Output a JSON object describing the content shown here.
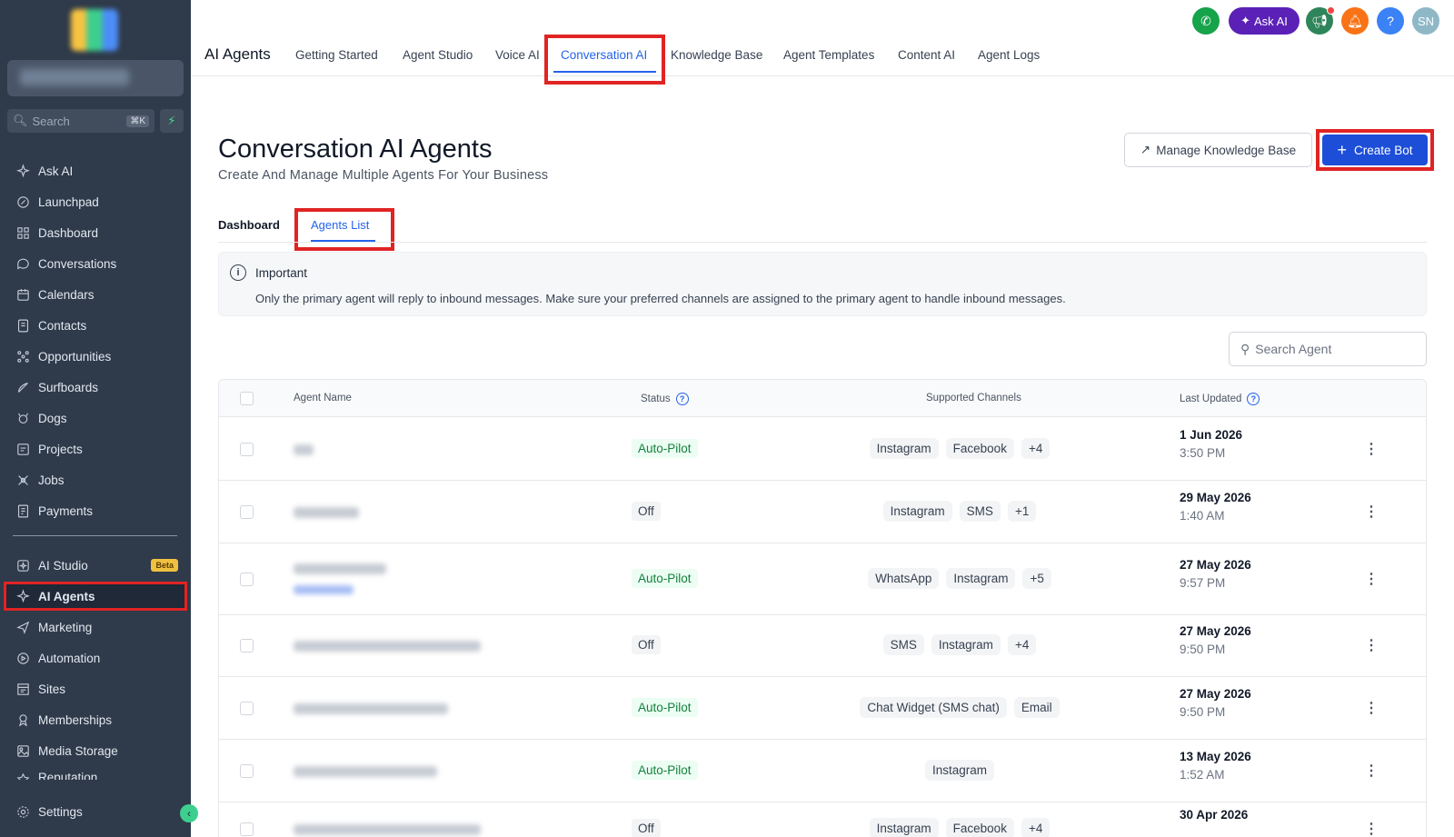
{
  "sidebar": {
    "search_placeholder": "Search",
    "search_shortcut": "⌘K",
    "items": [
      {
        "label": "Ask AI",
        "icon": "sparkle-icon"
      },
      {
        "label": "Launchpad",
        "icon": "rocket-icon"
      },
      {
        "label": "Dashboard",
        "icon": "grid-icon"
      },
      {
        "label": "Conversations",
        "icon": "chat-icon"
      },
      {
        "label": "Calendars",
        "icon": "calendar-icon"
      },
      {
        "label": "Contacts",
        "icon": "contacts-icon"
      },
      {
        "label": "Opportunities",
        "icon": "opportunities-icon"
      },
      {
        "label": "Surfboards",
        "icon": "surfboard-icon"
      },
      {
        "label": "Dogs",
        "icon": "dog-icon"
      },
      {
        "label": "Projects",
        "icon": "projects-icon"
      },
      {
        "label": "Jobs",
        "icon": "jobs-icon"
      },
      {
        "label": "Payments",
        "icon": "payments-icon"
      }
    ],
    "items2": [
      {
        "label": "AI Studio",
        "icon": "ai-studio-icon",
        "badge": "Beta"
      },
      {
        "label": "AI Agents",
        "icon": "sparkle-icon"
      },
      {
        "label": "Marketing",
        "icon": "send-icon"
      },
      {
        "label": "Automation",
        "icon": "automation-icon"
      },
      {
        "label": "Sites",
        "icon": "sites-icon"
      },
      {
        "label": "Memberships",
        "icon": "membership-icon"
      },
      {
        "label": "Media Storage",
        "icon": "image-icon"
      },
      {
        "label": "Reputation",
        "icon": "star-icon"
      }
    ],
    "settings_label": "Settings"
  },
  "topnav": {
    "brand": "AI Agents",
    "tabs": [
      "Getting Started",
      "Agent Studio",
      "Voice AI",
      "Conversation AI",
      "Knowledge Base",
      "Agent Templates",
      "Content AI",
      "Agent Logs"
    ],
    "active_tab": "Conversation AI",
    "ask_ai": "Ask AI",
    "help": "?",
    "avatar": "SN"
  },
  "page": {
    "title": "Conversation AI Agents",
    "subtitle": "Create And Manage Multiple Agents For Your Business",
    "manage_kb": "Manage Knowledge Base",
    "create_bot": "Create Bot",
    "subtabs": [
      "Dashboard",
      "Agents List"
    ],
    "notice_title": "Important",
    "notice_text": "Only the primary agent will reply to inbound messages. Make sure your preferred channels are assigned to the primary agent to handle inbound messages.",
    "search_agent": "Search Agent"
  },
  "table": {
    "headers": {
      "name": "Agent Name",
      "status": "Status",
      "channels": "Supported Channels",
      "updated": "Last Updated"
    },
    "rows": [
      {
        "status": "Auto-Pilot",
        "channels": [
          "Instagram",
          "Facebook",
          "+4"
        ],
        "date": "1 Jun 2026",
        "time": "3:50 PM"
      },
      {
        "status": "Off",
        "channels": [
          "Instagram",
          "SMS",
          "+1"
        ],
        "date": "29 May 2026",
        "time": "1:40 AM"
      },
      {
        "status": "Auto-Pilot",
        "channels": [
          "WhatsApp",
          "Instagram",
          "+5"
        ],
        "date": "27 May 2026",
        "time": "9:57 PM"
      },
      {
        "status": "Off",
        "channels": [
          "SMS",
          "Instagram",
          "+4"
        ],
        "date": "27 May 2026",
        "time": "9:50 PM"
      },
      {
        "status": "Auto-Pilot",
        "channels": [
          "Chat Widget (SMS chat)",
          "Email"
        ],
        "date": "27 May 2026",
        "time": "9:50 PM"
      },
      {
        "status": "Auto-Pilot",
        "channels": [
          "Instagram"
        ],
        "date": "13 May 2026",
        "time": "1:52 AM"
      },
      {
        "status": "Off",
        "channels": [
          "Instagram",
          "Facebook",
          "+4"
        ],
        "date": "30 Apr 2026",
        "time": ""
      }
    ]
  },
  "colors": {
    "sidebar": "#2f3a4a",
    "accent": "#2563eb",
    "highlight": "#e02424",
    "askai": "#5b21b6"
  }
}
